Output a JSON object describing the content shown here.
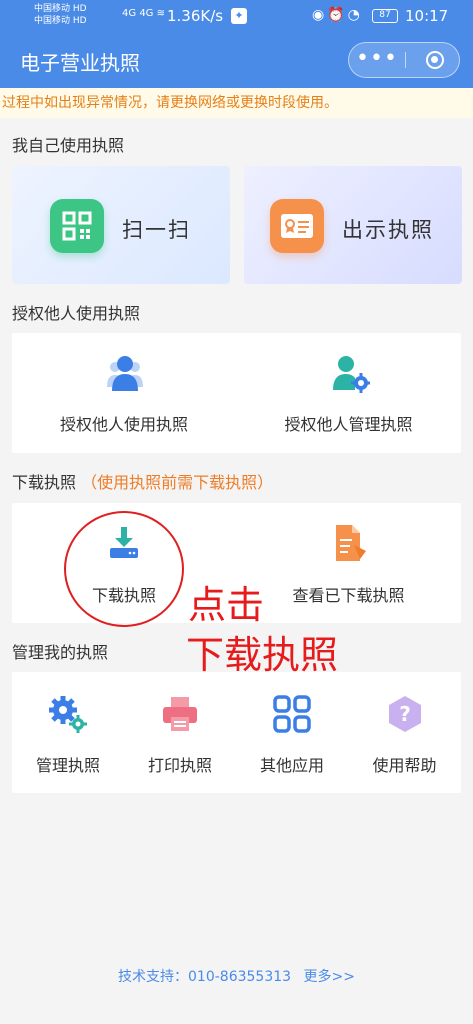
{
  "status_bar": {
    "carrier1": "中国移动 HD",
    "carrier2": "中国移动 HD",
    "network1": "4G",
    "network2": "4G",
    "speed": "1.36K/s",
    "battery": "87",
    "time": "10:17",
    "icons": [
      "wifi-icon",
      "eye-icon",
      "alarm-icon",
      "gauge-icon"
    ]
  },
  "navbar": {
    "title": "电子营业执照",
    "more_glyph": "•••",
    "more_icon": "more-dots-icon",
    "close_icon": "target-circle-icon"
  },
  "notice": {
    "text": "过程中如出现异常情况，请更换网络或更换时段使用。"
  },
  "section_self": {
    "title": "我自己使用执照",
    "scan_label": "扫一扫",
    "show_label": "出示执照"
  },
  "section_auth": {
    "title": "授权他人使用执照",
    "items": [
      {
        "label": "授权他人使用执照",
        "icon": "person-group-icon"
      },
      {
        "label": "授权他人管理执照",
        "icon": "person-gear-icon"
      }
    ]
  },
  "section_download": {
    "title": "下载执照",
    "hint": "（使用执照前需下载执照）",
    "items": [
      {
        "label": "下载执照",
        "icon": "download-tray-icon"
      },
      {
        "label": "查看已下载执照",
        "icon": "document-tag-icon"
      }
    ]
  },
  "section_manage": {
    "title": "管理我的执照",
    "items": [
      {
        "label": "管理执照",
        "icon": "gears-icon"
      },
      {
        "label": "打印执照",
        "icon": "printer-icon"
      },
      {
        "label": "其他应用",
        "icon": "grid-apps-icon"
      },
      {
        "label": "使用帮助",
        "icon": "question-icon"
      }
    ]
  },
  "annotation": {
    "line1": "点击",
    "line2": "下载执照"
  },
  "footer": {
    "text": "技术支持：010-86355313",
    "more": "更多>>"
  },
  "colors": {
    "primary": "#4a8be8",
    "notice_text": "#e57f18",
    "hint": "#ef7d27",
    "annotation": "#e61b1b"
  }
}
